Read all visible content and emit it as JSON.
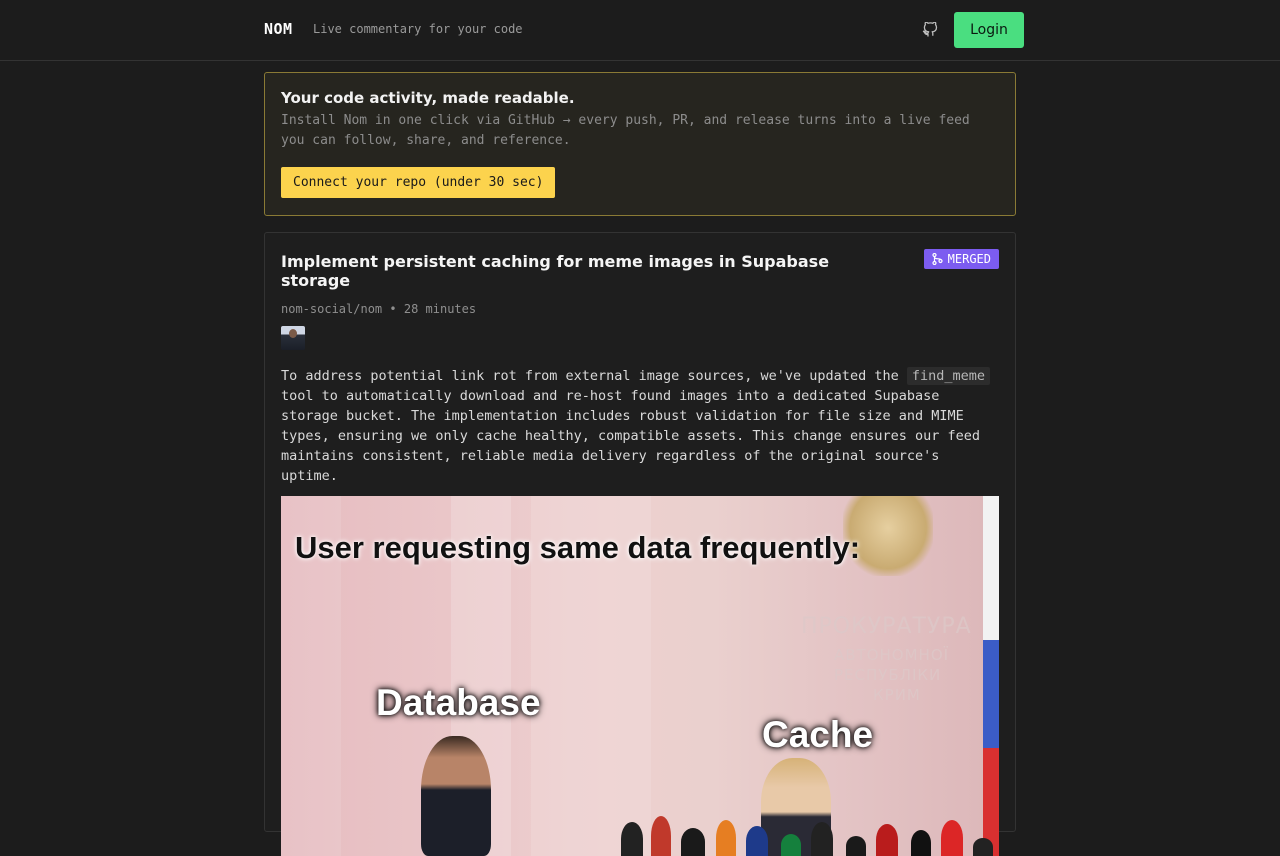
{
  "header": {
    "brand": "NOM",
    "tagline": "Live commentary for your code",
    "github_icon": "github-icon",
    "login_label": "Login"
  },
  "banner": {
    "title": "Your code activity, made readable.",
    "description": "Install Nom in one click via GitHub → every push, PR, and release turns into a live feed you can follow, share, and reference.",
    "cta_label": "Connect your repo (under 30 sec)"
  },
  "post": {
    "title": "Implement persistent caching for meme images in Supabase storage",
    "badge_label": "MERGED",
    "badge_icon": "merge-icon",
    "repo": "nom-social/nom",
    "separator": "•",
    "time": "28 minutes",
    "body_before": "To address potential link rot from external image sources, we've updated the",
    "code": "find_meme",
    "body_after": "tool to automatically download and re-host found images into a dedicated Supabase storage bucket. The implementation includes robust validation for file size and MIME types, ensuring we only cache healthy, compatible assets. This change ensures our feed maintains consistent, reliable media delivery regardless of the original source's uptime.",
    "meme": {
      "caption_top": "User requesting same data frequently:",
      "caption_left": "Database",
      "caption_right": "Cache",
      "wall_line1": "ПРОКУРАТУРА",
      "wall_line2": "АВТОНОМНОЇ",
      "wall_line3": "РЕСПУБЛІКИ",
      "wall_line4": "КРИМ"
    }
  },
  "colors": {
    "accent_green": "#4ade80",
    "accent_yellow": "#fcd34d",
    "merged_purple": "#7c5cf0"
  }
}
